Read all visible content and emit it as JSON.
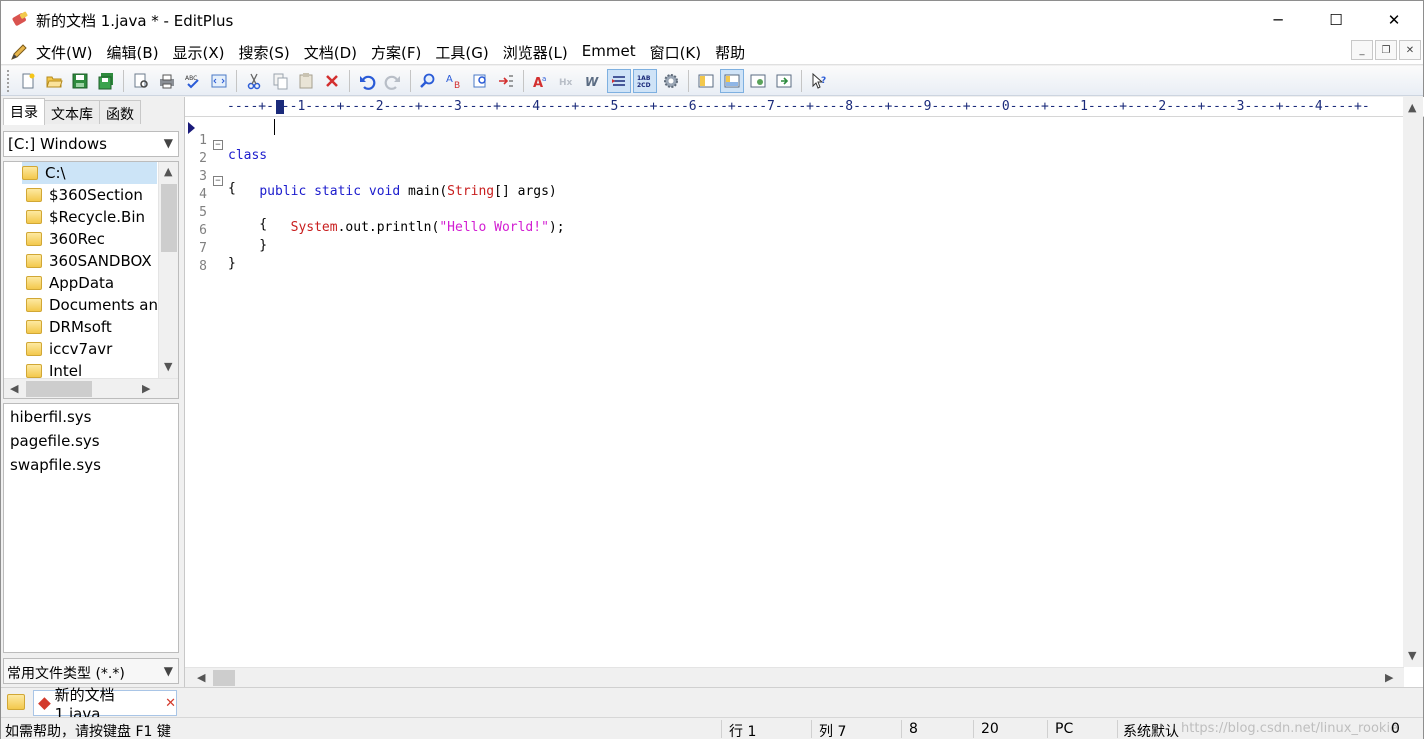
{
  "window": {
    "title": "新的文档 1.java * - EditPlus",
    "minimize": "─",
    "maximize": "☐",
    "close": "✕"
  },
  "menu": {
    "items": [
      "文件(W)",
      "编辑(B)",
      "显示(X)",
      "搜索(S)",
      "文档(D)",
      "方案(F)",
      "工具(G)",
      "浏览器(L)",
      "Emmet",
      "窗口(K)",
      "帮助"
    ],
    "mdi_minimize": "_",
    "mdi_restore": "❐",
    "mdi_close": "✕"
  },
  "toolbar": {
    "buttons": [
      "new-file",
      "open-file",
      "save",
      "save-all",
      "print-preview",
      "print",
      "spell-check",
      "html-preview",
      "cut",
      "copy",
      "paste",
      "delete",
      "undo",
      "redo",
      "find",
      "replace",
      "find-in-files",
      "goto",
      "font",
      "hex",
      "word-wrap",
      "line-numbers",
      "ruler-toggle",
      "settings",
      "directory-window",
      "output-window",
      "cliptext",
      "browser",
      "help"
    ]
  },
  "left_panel": {
    "tabs": [
      "目录",
      "文本库",
      "函数"
    ],
    "drive": "[C:] Windows",
    "tree": [
      "C:\\",
      "$360Section",
      "$Recycle.Bin",
      "360Rec",
      "360SANDBOX",
      "AppData",
      "Documents an",
      "DRMsoft",
      "iccv7avr",
      "Intel"
    ],
    "files": [
      "hiberfil.sys",
      "pagefile.sys",
      "swapfile.sys"
    ],
    "filter": "常用文件类型 (*.*)"
  },
  "editor": {
    "ruler": "----+----1----+----2----+----3----+----4----+----5----+----6----+----7----+----8----+----9----+----0----+----1----+----2----+----3----+----4----+-",
    "lines": [
      {
        "num": "1",
        "fold": ""
      },
      {
        "num": "2",
        "fold": "⊟"
      },
      {
        "num": "3",
        "fold": ""
      },
      {
        "num": "4",
        "fold": "⊟"
      },
      {
        "num": "5",
        "fold": ""
      },
      {
        "num": "6",
        "fold": ""
      },
      {
        "num": "7",
        "fold": ""
      },
      {
        "num": "8",
        "fold": ""
      }
    ],
    "code": {
      "l1_kw": "class",
      "l2": "{",
      "l3_indent": "    ",
      "l3_kw": "public static void",
      "l3_main": " main(",
      "l3_type": "String",
      "l3_rest": "[] args)",
      "l4": "    {",
      "l5_indent": "        ",
      "l5_type": "System",
      "l5_mid": ".out.println(",
      "l5_str": "\"Hello World!\"",
      "l5_end": ");",
      "l6": "    }",
      "l7": "}"
    }
  },
  "doc_tab": {
    "label": "新的文档 1.java",
    "close": "✕"
  },
  "status": {
    "help": "如需帮助，请按键盘 F1 键",
    "line": "行 1",
    "col": "列 7",
    "lines_total": "8",
    "num": "20",
    "format": "PC",
    "encoding": "系统默认",
    "zero": "0",
    "watermark": "https://blog.csdn.net/linux_rookie"
  }
}
